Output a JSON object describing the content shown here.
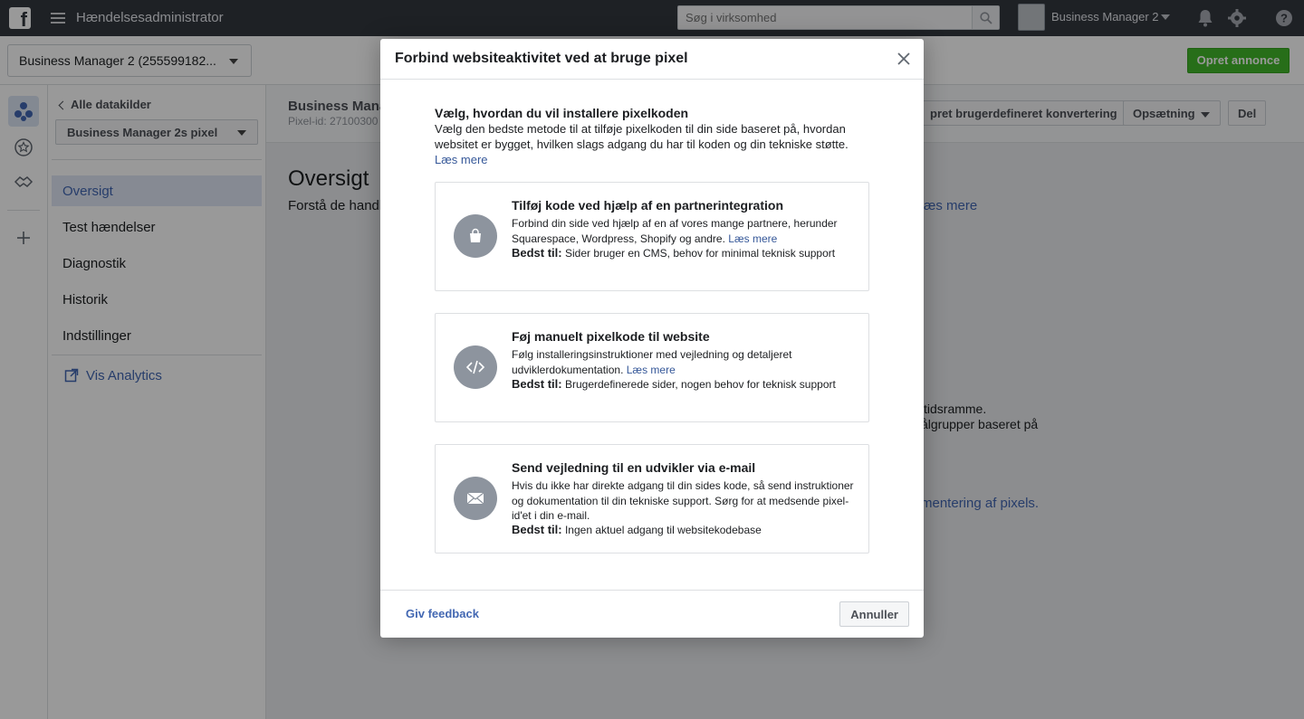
{
  "topbar": {
    "logo": "f",
    "app_title": "Hændelsesadministrator",
    "search_placeholder": "Søg i virksomhed",
    "business_name": "Business Manager 2"
  },
  "subheader": {
    "account_select": "Business Manager 2 (255599182...",
    "create_ad_label": "Opret annonce"
  },
  "nav": {
    "back_label": "Alle datakilder",
    "pixel_select": "Business Manager 2s pixel",
    "items": [
      {
        "label": "Oversigt",
        "active": true
      },
      {
        "label": "Test hændelser"
      },
      {
        "label": "Diagnostik"
      },
      {
        "label": "Historik"
      },
      {
        "label": "Indstillinger"
      }
    ],
    "analytics_label": "Vis Analytics"
  },
  "main": {
    "title": "Business Mana",
    "pixel_id": "Pixel-id: 27100300",
    "buttons": {
      "conversion": "pret brugerdefineret konvertering",
      "setup": "Opsætning",
      "share": "Del"
    },
    "overview_title": "Oversigt",
    "overview_sub": "Forstå de handli",
    "link_read_more": "æs mere",
    "text1": "tidsramme.",
    "text2": "ålgrupper baseret på",
    "link_pixels": "mentering af pixels."
  },
  "modal": {
    "title": "Forbind websiteaktivitet ved at bruge pixel",
    "intro_title": "Vælg, hvordan du vil installere pixelkoden",
    "intro_text": "Vælg den bedste metode til at tilføje pixelkoden til din side baseret på, hvordan websitet er bygget, hvilken slags adgang du har til koden og din tekniske støtte.",
    "read_more": "Læs mere",
    "best_for_label": "Bedst til:",
    "options": [
      {
        "title": "Tilføj kode ved hjælp af en partnerintegration",
        "desc": "Forbind din side ved hjælp af en af vores mange partnere, herunder Squarespace, Wordpress, Shopify og andre.",
        "link": "Læs mere",
        "best": "Sider bruger en CMS, behov for minimal teknisk support",
        "icon": "shopping-bag-icon"
      },
      {
        "title": "Føj manuelt pixelkode til website",
        "desc": "Følg installeringsinstruktioner med vejledning og detaljeret udviklerdokumentation.",
        "link": "Læs mere",
        "best": "Brugerdefinerede sider, nogen behov for teknisk support",
        "icon": "code-icon"
      },
      {
        "title": "Send vejledning til en udvikler via e-mail",
        "desc": "Hvis du ikke har direkte adgang til din sides kode, så send instruktioner og dokumentation til din tekniske support. Sørg for at medsende pixel-id'et i din e-mail.",
        "best": "Ingen aktuel adgang til websitekodebase",
        "icon": "envelope-icon"
      }
    ],
    "feedback_label": "Giv feedback",
    "cancel_label": "Annuller"
  },
  "colors": {
    "topbar": "#32373f",
    "primary_green": "#42b72a",
    "link_blue": "#385898",
    "icon_gray": "#8d949e"
  }
}
